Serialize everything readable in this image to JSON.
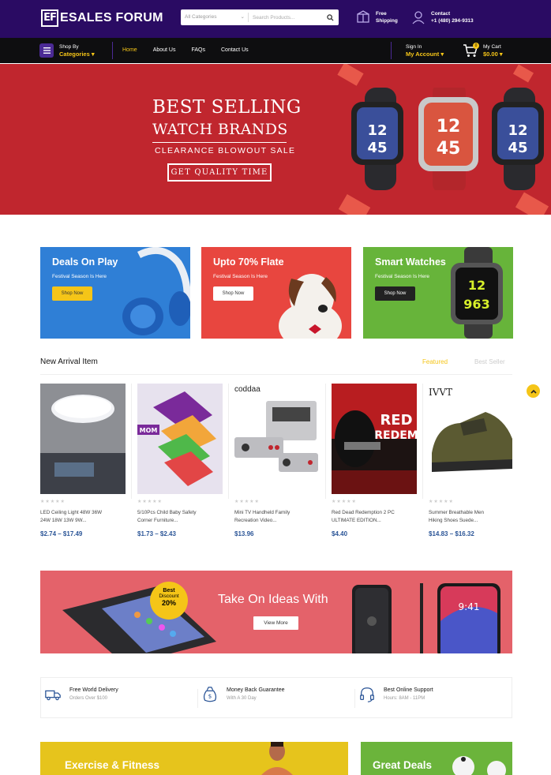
{
  "header": {
    "logo_mark": "EF",
    "logo_text": "ESALES FORUM",
    "search_category": "All Categories",
    "search_placeholder": "Search Products...",
    "shipping_line1": "Free",
    "shipping_line2": "Shipping",
    "contact_line1": "Contact",
    "contact_line2": "+1 (480) 294-9313"
  },
  "nav": {
    "shop_by": "Shop By",
    "categories": "Categories",
    "links": [
      "Home",
      "About Us",
      "FAQs",
      "Contact Us"
    ],
    "active": "Home",
    "signin": "Sign In",
    "account": "My Account",
    "cart_label": "My Cart",
    "cart_total": "$0.00",
    "cart_count": "0"
  },
  "hero": {
    "line1": "BEST SELLING",
    "line2": "WATCH BRANDS",
    "line3": "CLEARANCE  BLOWOUT  SALE",
    "cta": "GET QUALITY TIME",
    "watch_time": [
      "12",
      "45"
    ]
  },
  "promos": [
    {
      "title": "Deals On Play",
      "subtitle": "Festival Season Is Here",
      "button": "Shop Now",
      "bg": "#2f7fd6"
    },
    {
      "title": "Upto 70% Flate",
      "subtitle": "Festival Season Is Here",
      "button": "Shop Now",
      "bg": "#e8463f"
    },
    {
      "title": "Smart Watches",
      "subtitle": "Festival Season Is Here",
      "button": "Shop Now",
      "bg": "#67b43a"
    }
  ],
  "new_arrival": {
    "title": "New Arrival Item",
    "tabs": [
      "Featured",
      "Best Seller"
    ],
    "products": [
      {
        "name_line1": "LED Ceiling Light 48W 36W",
        "name_line2": "24W 18W 13W 9W...",
        "price": "$2.74 – $17.49",
        "stars": "★★★★★"
      },
      {
        "name_line1": "5/10Pcs Child Baby Safety",
        "name_line2": "Corner Furniture...",
        "price": "$1.73 – $2.43",
        "stars": "★★★★★",
        "badge": "MOM"
      },
      {
        "name_line1": "Mini TV Handheld Family",
        "name_line2": "Recreation Video...",
        "price": "$13.96",
        "stars": "★★★★★",
        "brand": "coddaa"
      },
      {
        "name_line1": "Red Dead Redemption 2 PC",
        "name_line2": "ULTIMATE EDITION...",
        "price": "$4.40",
        "stars": "★★★★★",
        "art_text": "RED DEAD REDEM"
      },
      {
        "name_line1": "Summer Breathable Men",
        "name_line2": "Hiking Shoes Suede...",
        "price": "$14.83 – $16.32",
        "stars": "★★★★★",
        "brand": "IVVT"
      }
    ]
  },
  "mid_banner": {
    "heading": "Take On Ideas With",
    "button": "View More",
    "badge_l1": "Best",
    "badge_l2": "Discount",
    "badge_l3": "20%",
    "phone_time": "9:41"
  },
  "features": [
    {
      "title": "Free World Delivery",
      "sub": "Orders Over $100"
    },
    {
      "title": "Money Back Guarantee",
      "sub": "With A 30 Day"
    },
    {
      "title": "Best Online Support",
      "sub": "Hours: 8AM - 11PM"
    }
  ],
  "bottom": {
    "left": "Exercise & Fitness",
    "right": "Great Deals"
  },
  "colors": {
    "header_bg": "#2a0b63",
    "nav_bg": "#0e0e10",
    "accent": "#f5c518",
    "hero_bg": "#c0262e",
    "price": "#2b5597"
  }
}
